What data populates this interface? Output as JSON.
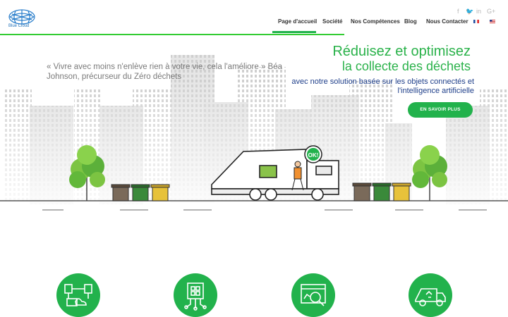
{
  "brand": {
    "logo_text": "Blue Cloud"
  },
  "nav": {
    "items": [
      {
        "label": "Page d'accueil",
        "active": true
      },
      {
        "label": "Société"
      },
      {
        "label": "Nos Compétences"
      },
      {
        "label": "Blog"
      },
      {
        "label": "Nous Contacter"
      }
    ],
    "languages": [
      "fr-flag-icon",
      "us-flag-icon"
    ]
  },
  "social": [
    {
      "icon": "facebook-icon",
      "glyph": "f"
    },
    {
      "icon": "twitter-icon",
      "glyph": "🐦"
    },
    {
      "icon": "linkedin-icon",
      "glyph": "in"
    },
    {
      "icon": "google-plus-icon",
      "glyph": "G+"
    }
  ],
  "hero": {
    "quote": "« Vivre avec moins n'enlève rien à votre vie, cela l'améliore » Béa Johnson, précurseur du Zéro déchets",
    "title_line1": "Réduisez et optimisez",
    "title_line2": "la collecte des déchets",
    "subtitle": "avec notre solution basée sur les objets connectés et l'intelligence artificielle",
    "cta": "EN SAVOIR PLUS",
    "speech_bubble": "OK!"
  },
  "features": [
    {
      "icon": "iot-network-icon"
    },
    {
      "icon": "ai-chip-icon"
    },
    {
      "icon": "analytics-icon"
    },
    {
      "icon": "recycling-truck-icon"
    }
  ],
  "colors": {
    "accent": "#22b24c",
    "title": "#2ab24a",
    "subtitle": "#1f3f8a",
    "quote": "#7a7a7a"
  }
}
